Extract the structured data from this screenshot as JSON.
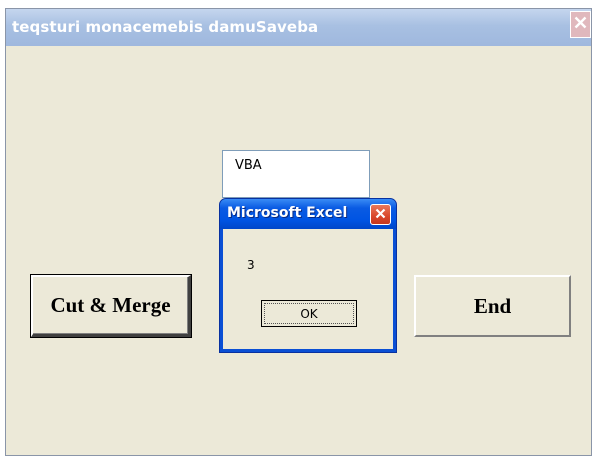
{
  "window": {
    "title": "teqsturi monacemebis damuSaveba",
    "close_icon": "close-icon"
  },
  "textbox": {
    "value": "VBA"
  },
  "buttons": {
    "cut_merge": "Cut & Merge",
    "end": "End"
  },
  "msgbox": {
    "title": "Microsoft Excel",
    "message": "3",
    "ok_label": "OK",
    "close_icon": "close-icon"
  },
  "colors": {
    "window_bg": "#ece9d8",
    "titlebar": "#a8c0e2",
    "msg_titlebar": "#0054e3",
    "msg_close": "#d9472b"
  }
}
